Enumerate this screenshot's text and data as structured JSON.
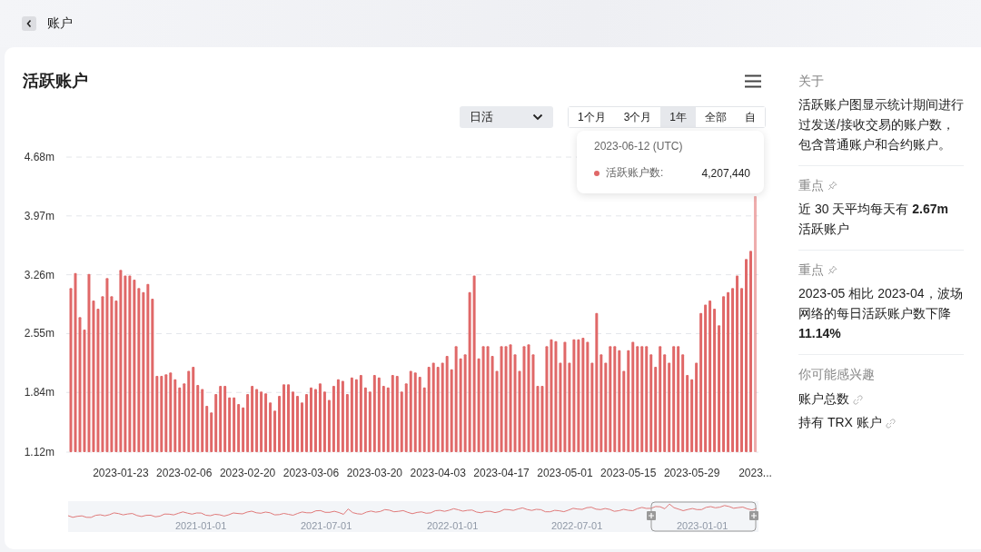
{
  "header": {
    "title": "账户"
  },
  "chart_panel": {
    "title": "活跃账户",
    "metric_select": {
      "value": "日活"
    },
    "ranges": [
      {
        "label": "1个月",
        "selected": false
      },
      {
        "label": "3个月",
        "selected": false
      },
      {
        "label": "1年",
        "selected": true
      },
      {
        "label": "全部",
        "selected": false
      },
      {
        "label": "自",
        "selected": false
      }
    ],
    "tooltip": {
      "date": "2023-06-12 (UTC)",
      "series": "活跃账户数:",
      "value": "4,207,440"
    },
    "chart_data": {
      "type": "bar",
      "grid": true,
      "ylim": [
        1.12,
        4.68
      ],
      "categories": [
        null,
        null,
        null,
        null,
        null,
        null,
        null,
        null,
        null,
        null,
        null,
        "2023-01-23",
        null,
        null,
        null,
        null,
        null,
        null,
        null,
        null,
        null,
        null,
        null,
        null,
        null,
        "2023-02-06",
        null,
        null,
        null,
        null,
        null,
        null,
        null,
        null,
        null,
        null,
        null,
        null,
        null,
        "2023-02-20",
        null,
        null,
        null,
        null,
        null,
        null,
        null,
        null,
        null,
        null,
        null,
        null,
        null,
        "2023-03-06",
        null,
        null,
        null,
        null,
        null,
        null,
        null,
        null,
        null,
        null,
        null,
        null,
        null,
        "2023-03-20",
        null,
        null,
        null,
        null,
        null,
        null,
        null,
        null,
        null,
        null,
        null,
        null,
        null,
        "2023-04-03",
        null,
        null,
        null,
        null,
        null,
        null,
        null,
        null,
        null,
        null,
        null,
        null,
        null,
        "2023-04-17",
        null,
        null,
        null,
        null,
        null,
        null,
        null,
        null,
        null,
        null,
        null,
        null,
        null,
        "2023-05-01",
        null,
        null,
        null,
        null,
        null,
        null,
        null,
        null,
        null,
        null,
        null,
        null,
        null,
        "2023-05-15",
        null,
        null,
        null,
        null,
        null,
        null,
        null,
        null,
        null,
        null,
        null,
        null,
        null,
        "2023-05-29",
        null,
        null,
        null,
        null,
        null,
        null,
        null,
        null,
        null,
        null,
        null,
        null,
        null,
        "2023..."
      ],
      "yticks": [
        {
          "value": 1.12,
          "label": "1.12m"
        },
        {
          "value": 1.84,
          "label": "1.84m"
        },
        {
          "value": 2.55,
          "label": "2.55m"
        },
        {
          "value": 3.26,
          "label": "3.26m"
        },
        {
          "value": 3.97,
          "label": "3.97m"
        },
        {
          "value": 4.68,
          "label": "4.68m"
        }
      ],
      "series": [
        {
          "color": "#e06868",
          "values": [
            3.1,
            3.28,
            2.75,
            2.6,
            3.27,
            2.95,
            2.85,
            3.0,
            3.22,
            3.0,
            2.95,
            3.32,
            3.25,
            3.25,
            3.2,
            3.1,
            3.05,
            3.15,
            2.97,
            2.04,
            2.04,
            2.06,
            2.08,
            2.0,
            1.9,
            1.95,
            2.1,
            2.15,
            1.93,
            1.88,
            1.68,
            1.6,
            1.82,
            1.92,
            1.92,
            1.78,
            1.78,
            1.7,
            1.66,
            1.82,
            1.92,
            1.88,
            1.85,
            1.83,
            1.72,
            1.62,
            1.8,
            1.94,
            1.94,
            1.85,
            1.8,
            1.72,
            1.82,
            1.9,
            1.88,
            1.95,
            1.85,
            1.75,
            1.92,
            2.0,
            1.98,
            1.82,
            2.02,
            2.0,
            2.05,
            1.9,
            1.85,
            2.05,
            2.02,
            1.92,
            1.9,
            2.05,
            2.04,
            1.85,
            1.95,
            2.1,
            2.08,
            2.03,
            1.9,
            2.15,
            2.2,
            2.15,
            2.2,
            2.28,
            2.12,
            2.4,
            2.25,
            2.3,
            3.05,
            3.25,
            2.25,
            2.4,
            2.4,
            2.28,
            2.1,
            2.4,
            2.4,
            2.42,
            2.3,
            2.1,
            2.4,
            2.42,
            2.3,
            1.92,
            1.92,
            2.4,
            2.48,
            2.46,
            2.2,
            2.45,
            2.2,
            2.48,
            2.48,
            2.5,
            2.45,
            2.2,
            2.8,
            2.3,
            2.2,
            2.4,
            2.4,
            2.35,
            2.1,
            2.35,
            2.45,
            2.4,
            2.4,
            2.4,
            2.3,
            2.15,
            2.4,
            2.3,
            2.2,
            2.4,
            2.4,
            2.3,
            2.05,
            2.0,
            2.2,
            2.8,
            2.9,
            2.95,
            2.85,
            2.65,
            3.0,
            3.05,
            3.1,
            3.25,
            3.1,
            3.45,
            3.55,
            4.21
          ]
        }
      ]
    },
    "navigator": {
      "labels": [
        "2021-01-01",
        "2021-07-01",
        "2022-01-01",
        "2022-07-01",
        "2023-01-01"
      ]
    }
  },
  "sidebar": {
    "about": {
      "heading": "关于",
      "text": "活跃账户图显示统计期间进行过发送/接收交易的账户数，包含普通账户和合约账户。"
    },
    "highlights": [
      {
        "heading": "重点",
        "text": "近 30 天平均每天有 **2.67m** 活跃账户"
      },
      {
        "heading": "重点",
        "text": "2023-05 相比 2023-04，波场网络的每日活跃账户数下降 **11.14%**"
      }
    ],
    "related": {
      "heading": "你可能感兴趣",
      "links": [
        "账户总数",
        "持有 TRX 账户"
      ]
    }
  }
}
